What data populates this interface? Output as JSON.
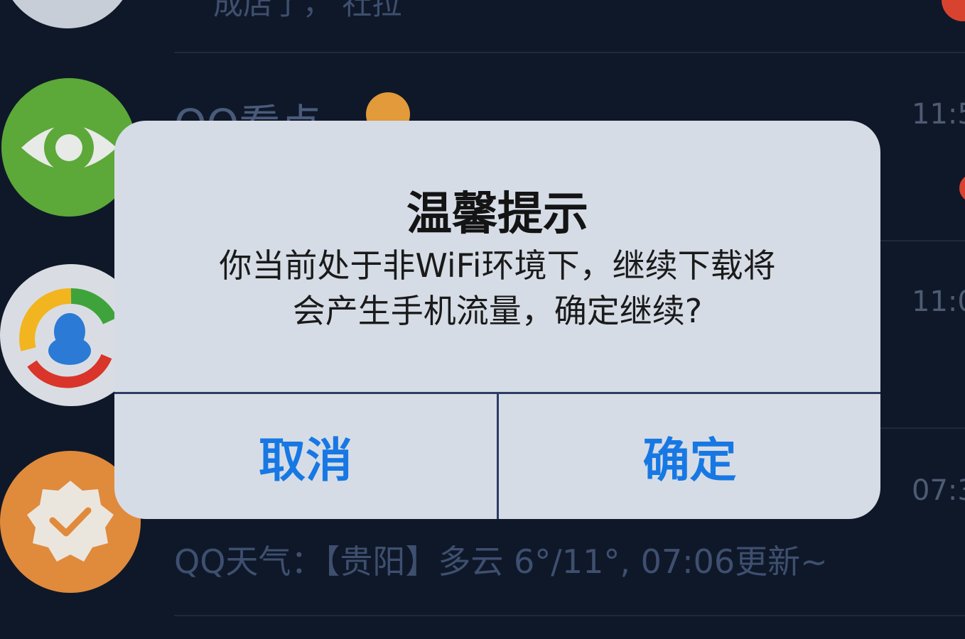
{
  "alert": {
    "title": "温馨提示",
    "message_line1": "你当前处于非WiFi环境下，继续下载将",
    "message_line2": "会产生手机流量，确定继续?",
    "cancel_label": "取消",
    "confirm_label": "确定"
  },
  "background_list": {
    "row1_preview": "成店了， 社拉",
    "row2_name": "QQ看点",
    "row2_time": "11:5",
    "row3_time": "11:0",
    "row4_time": "07:3",
    "row4_preview": "QQ天气：【贵阳】多云 6°/11°, 07:06更新~"
  },
  "colors": {
    "background": "#0f1829",
    "alert_bg": "#d6dce6",
    "button_text": "#1778e3",
    "separator": "#2c3d63"
  }
}
